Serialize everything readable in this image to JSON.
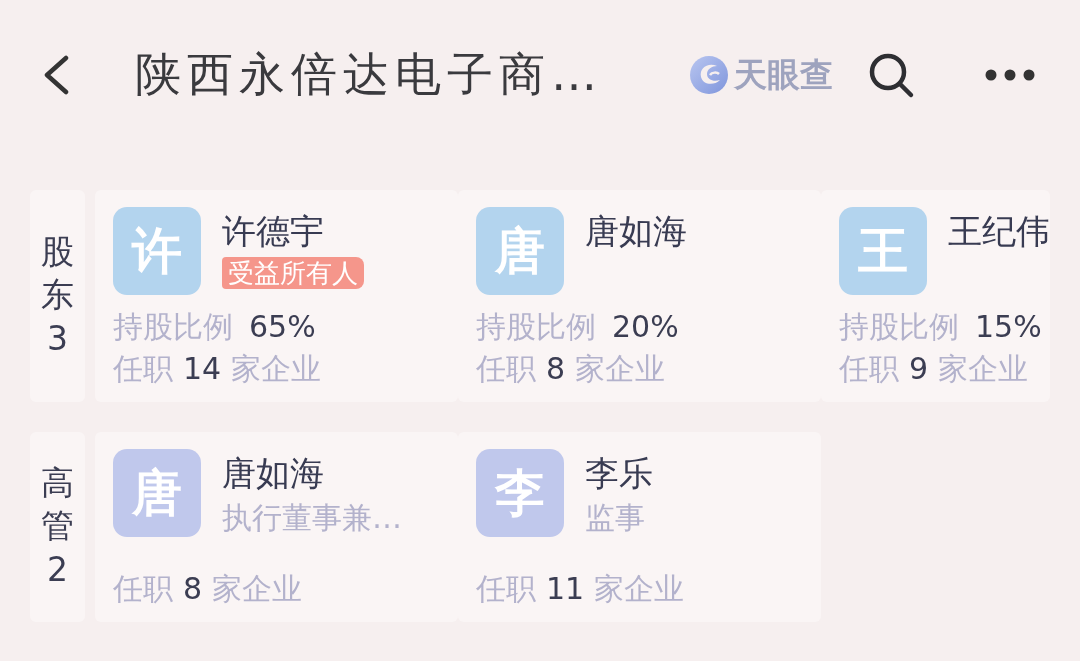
{
  "header": {
    "title": "陕西永倍达电子商…",
    "brand": "天眼查"
  },
  "sections": [
    {
      "kind": "shareholders",
      "label": "股东",
      "count": "3",
      "people": [
        {
          "avatar": "许",
          "name": "许德宇",
          "badge": "受益所有人",
          "share_label": "持股比例",
          "share": "65%",
          "post_label": "任职",
          "post_count": "14",
          "post_unit": "家企业"
        },
        {
          "avatar": "唐",
          "name": "唐如海",
          "share_label": "持股比例",
          "share": "20%",
          "post_label": "任职",
          "post_count": "8",
          "post_unit": "家企业"
        },
        {
          "avatar": "王",
          "name": "王纪伟",
          "share_label": "持股比例",
          "share": "15%",
          "post_label": "任职",
          "post_count": "9",
          "post_unit": "家企业"
        }
      ]
    },
    {
      "kind": "executives",
      "label": "高管",
      "count": "2",
      "people": [
        {
          "avatar": "唐",
          "name": "唐如海",
          "role": "执行董事兼…",
          "post_label": "任职",
          "post_count": "8",
          "post_unit": "家企业"
        },
        {
          "avatar": "李",
          "name": "李乐",
          "role": "监事",
          "post_label": "任职",
          "post_count": "11",
          "post_unit": "家企业"
        }
      ]
    }
  ]
}
